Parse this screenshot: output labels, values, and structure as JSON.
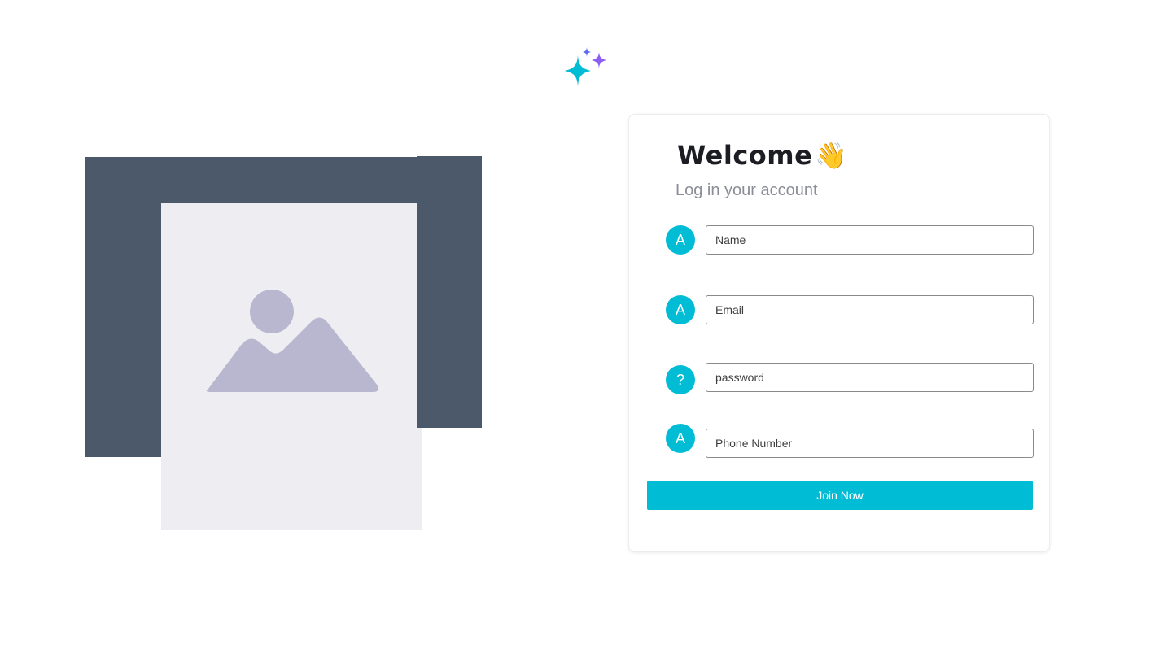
{
  "logo": {
    "icon": "sparkles-icon"
  },
  "illustration": {
    "icon": "image-placeholder-icon"
  },
  "card": {
    "title": "Welcome",
    "title_emoji": "👋",
    "subtitle": "Log in your account"
  },
  "form": {
    "fields": [
      {
        "badge": "A",
        "placeholder": "Name"
      },
      {
        "badge": "A",
        "placeholder": "Email"
      },
      {
        "badge": "?",
        "placeholder": "password"
      },
      {
        "badge": "A",
        "placeholder": "Phone Number"
      }
    ],
    "submit_label": "Join Now"
  },
  "colors": {
    "accent": "#00bcd4",
    "illustration_back": "#4b596b",
    "illustration_front": "#ededf2",
    "placeholder_icon": "#b8b7cf",
    "sparkle_cyan": "#00bcd4",
    "sparkle_purple": "#8b5cf6",
    "sparkle_blue": "#5b6cf0"
  }
}
